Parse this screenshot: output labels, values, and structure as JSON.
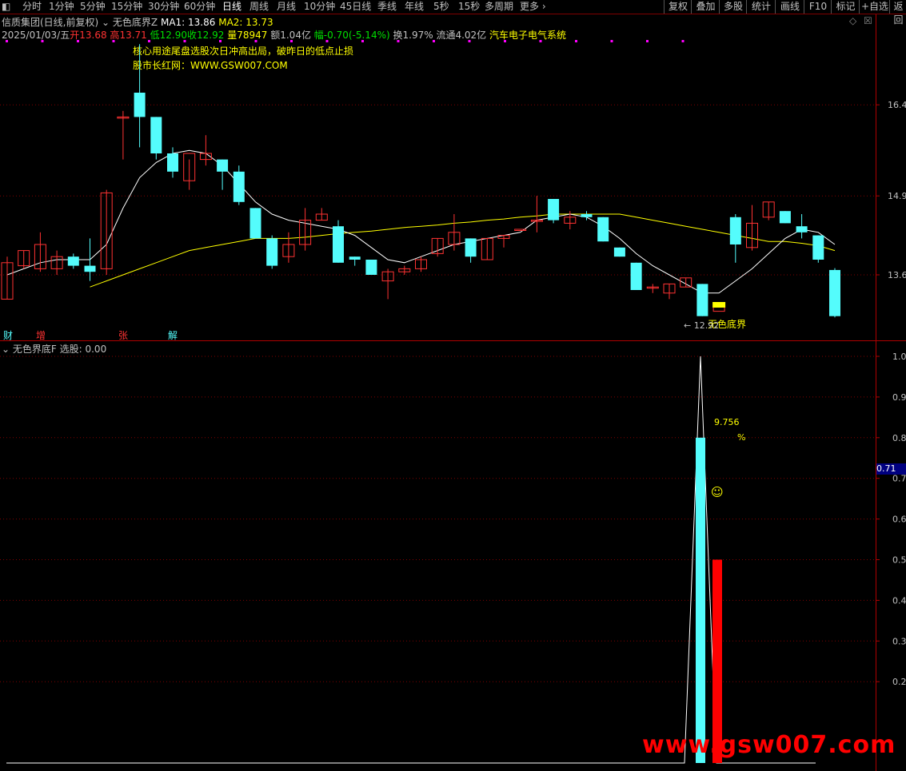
{
  "toolbar": {
    "tabs": [
      "分时",
      "1分钟",
      "5分钟",
      "15分钟",
      "30分钟",
      "60分钟",
      "日线",
      "周线",
      "月线",
      "10分钟",
      "45日线",
      "季线",
      "年线",
      "5秒",
      "15秒",
      "多周期",
      "更多"
    ],
    "active_tab": "日线",
    "right_buttons": [
      "复权",
      "叠加",
      "多股",
      "统计",
      "画线",
      "F10",
      "标记",
      "+自选",
      "返回"
    ]
  },
  "stock": {
    "title": "信质集团(日线,前复权)",
    "indicator_label": "无色底界Z",
    "ma1": "MA1: 13.86",
    "ma2": "MA2: 13.73",
    "date": "2025/01/03/五",
    "open_label": "开",
    "open": "13.68",
    "high_label": "高",
    "high": "13.71",
    "low_label": "低",
    "low": "12.90",
    "close_label": "收",
    "close": "12.92",
    "vol_label": "量",
    "vol": "78947",
    "amount": "额1.04亿",
    "change": "幅-0.70(-5.14%)",
    "turnover": "换1.97%",
    "float": "流通4.02亿",
    "sector": "汽车电子电气系统"
  },
  "notes": {
    "line1": "核心用途尾盘选股次日冲高出局，破昨日的低点止损",
    "line2": "股市长红网：WWW.GSW007.COM"
  },
  "annotations": {
    "signal_text": "无色底界",
    "low_marker": "← 12.92",
    "tags": [
      "财",
      "增",
      "张",
      "解"
    ],
    "lower_pct": "9.756",
    "pct_sign": "%"
  },
  "lower_panel": {
    "title": "无色界底F",
    "value_label": "选股: 0.00",
    "current_value": "0.71"
  },
  "watermark": "www.gsw007.com",
  "colors": {
    "up": "#ff3232",
    "down": "#54fcfc",
    "ma1": "#ffffff",
    "ma2": "#ffff00",
    "signal": "#ffff00",
    "bar_red": "#ff0000",
    "grid": "#800000"
  },
  "chart_data": {
    "type": "candlestick",
    "y_ticks_upper": [
      "16.4",
      "14.9",
      "13.6"
    ],
    "y_ticks_lower": [
      "1.0",
      "0.9",
      "0.8",
      "0.7",
      "0.6",
      "0.5",
      "0.4",
      "0.3",
      "0.2"
    ],
    "ylim_upper": [
      12.6,
      17.6
    ],
    "ylim_lower": [
      0.0,
      1.0
    ],
    "candles": [
      {
        "o": 13.2,
        "h": 13.9,
        "l": 13.2,
        "c": 13.8
      },
      {
        "o": 13.75,
        "h": 14.0,
        "l": 13.7,
        "c": 14.0
      },
      {
        "o": 13.7,
        "h": 14.3,
        "l": 13.65,
        "c": 14.1
      },
      {
        "o": 13.7,
        "h": 14.0,
        "l": 13.6,
        "c": 13.9
      },
      {
        "o": 13.9,
        "h": 13.95,
        "l": 13.7,
        "c": 13.75
      },
      {
        "o": 13.75,
        "h": 14.2,
        "l": 13.5,
        "c": 13.65
      },
      {
        "o": 13.7,
        "h": 15.0,
        "l": 13.6,
        "c": 14.95
      },
      {
        "o": 16.2,
        "h": 16.3,
        "l": 15.5,
        "c": 16.2
      },
      {
        "o": 16.6,
        "h": 17.4,
        "l": 15.7,
        "c": 16.2
      },
      {
        "o": 16.2,
        "h": 16.2,
        "l": 15.5,
        "c": 15.6
      },
      {
        "o": 15.6,
        "h": 15.7,
        "l": 15.2,
        "c": 15.3
      },
      {
        "o": 15.15,
        "h": 15.5,
        "l": 15.0,
        "c": 15.6
      },
      {
        "o": 15.5,
        "h": 15.9,
        "l": 15.4,
        "c": 15.6
      },
      {
        "o": 15.5,
        "h": 15.5,
        "l": 15.0,
        "c": 15.3
      },
      {
        "o": 15.3,
        "h": 15.4,
        "l": 14.75,
        "c": 14.8
      },
      {
        "o": 14.7,
        "h": 14.7,
        "l": 14.2,
        "c": 14.2
      },
      {
        "o": 14.2,
        "h": 14.25,
        "l": 13.7,
        "c": 13.75
      },
      {
        "o": 13.9,
        "h": 14.3,
        "l": 13.8,
        "c": 14.1
      },
      {
        "o": 14.1,
        "h": 14.7,
        "l": 14.0,
        "c": 14.5
      },
      {
        "o": 14.5,
        "h": 14.7,
        "l": 14.5,
        "c": 14.6
      },
      {
        "o": 14.4,
        "h": 14.5,
        "l": 13.8,
        "c": 13.8
      },
      {
        "o": 13.9,
        "h": 13.9,
        "l": 13.75,
        "c": 13.85
      },
      {
        "o": 13.85,
        "h": 13.85,
        "l": 13.6,
        "c": 13.6
      },
      {
        "o": 13.5,
        "h": 13.7,
        "l": 13.2,
        "c": 13.65
      },
      {
        "o": 13.65,
        "h": 13.75,
        "l": 13.6,
        "c": 13.7
      },
      {
        "o": 13.7,
        "h": 13.9,
        "l": 13.65,
        "c": 13.85
      },
      {
        "o": 13.95,
        "h": 14.2,
        "l": 13.9,
        "c": 14.2
      },
      {
        "o": 14.1,
        "h": 14.6,
        "l": 14.0,
        "c": 14.3
      },
      {
        "o": 14.2,
        "h": 14.2,
        "l": 13.8,
        "c": 13.9
      },
      {
        "o": 13.85,
        "h": 14.2,
        "l": 13.85,
        "c": 14.2
      },
      {
        "o": 14.2,
        "h": 14.25,
        "l": 14.05,
        "c": 14.25
      },
      {
        "o": 14.35,
        "h": 14.35,
        "l": 14.35,
        "c": 14.35
      },
      {
        "o": 14.5,
        "h": 14.9,
        "l": 14.3,
        "c": 14.5
      },
      {
        "o": 14.85,
        "h": 14.85,
        "l": 14.45,
        "c": 14.5
      },
      {
        "o": 14.45,
        "h": 14.65,
        "l": 14.35,
        "c": 14.55
      },
      {
        "o": 14.6,
        "h": 14.65,
        "l": 14.5,
        "c": 14.55
      },
      {
        "o": 14.55,
        "h": 14.55,
        "l": 14.15,
        "c": 14.15
      },
      {
        "o": 14.05,
        "h": 14.05,
        "l": 13.9,
        "c": 13.9
      },
      {
        "o": 13.8,
        "h": 13.8,
        "l": 13.35,
        "c": 13.35
      },
      {
        "o": 13.4,
        "h": 13.45,
        "l": 13.3,
        "c": 13.4
      },
      {
        "o": 13.3,
        "h": 13.45,
        "l": 13.2,
        "c": 13.45
      },
      {
        "o": 13.4,
        "h": 13.55,
        "l": 13.4,
        "c": 13.55
      },
      {
        "o": 13.45,
        "h": 13.45,
        "l": 12.92,
        "c": 12.92
      },
      {
        "o": 13.0,
        "h": 13.0,
        "l": 13.0,
        "c": 13.1
      },
      {
        "o": 14.55,
        "h": 14.6,
        "l": 13.8,
        "c": 14.1
      },
      {
        "o": 14.05,
        "h": 14.75,
        "l": 14.0,
        "c": 14.45
      },
      {
        "o": 14.55,
        "h": 14.8,
        "l": 14.5,
        "c": 14.8
      },
      {
        "o": 14.65,
        "h": 14.65,
        "l": 14.45,
        "c": 14.45
      },
      {
        "o": 14.4,
        "h": 14.6,
        "l": 14.2,
        "c": 14.3
      },
      {
        "o": 14.25,
        "h": 14.25,
        "l": 13.8,
        "c": 13.85
      },
      {
        "o": 13.68,
        "h": 13.71,
        "l": 12.9,
        "c": 12.92
      }
    ],
    "ma1": [
      13.6,
      13.7,
      13.8,
      13.85,
      13.85,
      13.85,
      14.1,
      14.7,
      15.2,
      15.45,
      15.6,
      15.65,
      15.6,
      15.4,
      15.1,
      14.8,
      14.6,
      14.5,
      14.45,
      14.4,
      14.35,
      14.25,
      14.05,
      13.85,
      13.8,
      13.9,
      14.0,
      14.1,
      14.15,
      14.2,
      14.25,
      14.3,
      14.5,
      14.55,
      14.6,
      14.55,
      14.4,
      14.2,
      13.95,
      13.75,
      13.6,
      13.45,
      13.3,
      13.3,
      13.5,
      13.7,
      13.95,
      14.2,
      14.35,
      14.3,
      14.1
    ],
    "ma2": [
      12.95,
      13.0,
      13.1,
      13.2,
      13.3,
      13.4,
      13.5,
      13.6,
      13.7,
      13.8,
      13.9,
      14.0,
      14.05,
      14.1,
      14.15,
      14.2,
      14.2,
      14.2,
      14.22,
      14.25,
      14.28,
      14.3,
      14.32,
      14.35,
      14.38,
      14.4,
      14.42,
      14.45,
      14.47,
      14.5,
      14.52,
      14.55,
      14.57,
      14.6,
      14.6,
      14.6,
      14.6,
      14.6,
      14.55,
      14.5,
      14.45,
      14.4,
      14.35,
      14.3,
      14.25,
      14.2,
      14.15,
      14.15,
      14.12,
      14.08,
      14.0
    ],
    "lower_series": [
      {
        "name": "selection",
        "values": [
          0,
          0,
          0,
          0,
          0,
          0,
          0,
          0,
          0,
          0,
          0,
          0,
          0,
          0,
          0,
          0,
          0,
          0,
          0,
          0,
          0,
          0,
          0,
          0,
          0,
          0,
          0,
          0,
          0,
          0,
          0,
          0,
          0,
          0,
          0,
          0,
          0,
          0,
          0,
          0,
          0,
          0,
          0,
          1.0,
          0,
          0,
          0,
          0,
          0,
          0,
          0
        ]
      },
      {
        "name": "cyan_bar",
        "index": 43,
        "value": 0.8
      },
      {
        "name": "red_bar",
        "index": 44,
        "value": 0.5
      }
    ]
  }
}
